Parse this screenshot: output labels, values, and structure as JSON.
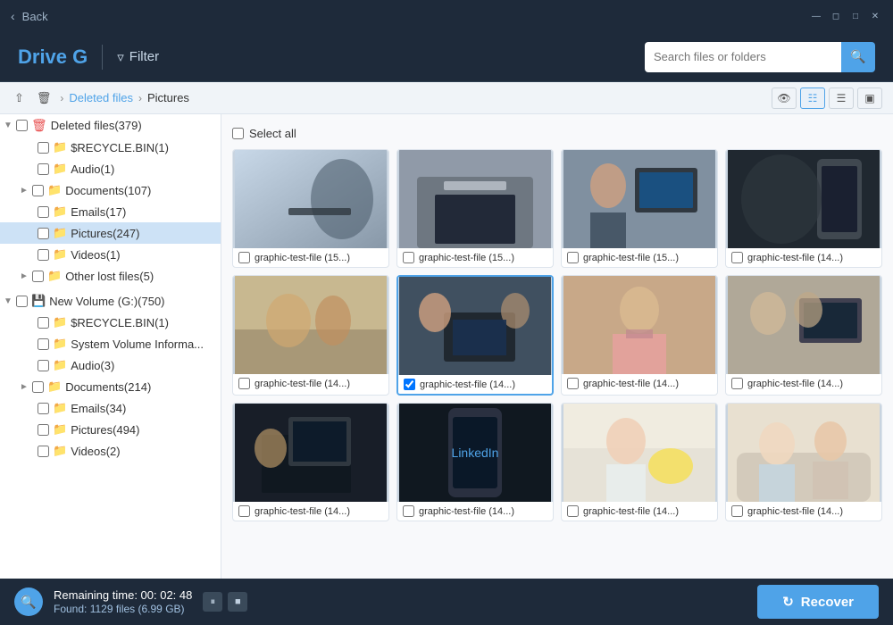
{
  "titleBar": {
    "back_label": "Back",
    "controls": [
      "minimize",
      "maximize",
      "restore",
      "close"
    ]
  },
  "header": {
    "drive_title": "Drive G",
    "filter_label": "Filter",
    "search_placeholder": "Search files or folders"
  },
  "breadcrumb": {
    "up_label": "↑",
    "delete_label": "🗑",
    "items": [
      "Deleted files",
      "Pictures"
    ],
    "view_eye": "👁",
    "view_grid": "⊞",
    "view_list": "≡",
    "view_detail": "⊟"
  },
  "sidebar": {
    "deletedFiles": {
      "label": "Deleted files(379)",
      "children": [
        {
          "label": "$RECYCLE.BIN(1)",
          "indent": 1
        },
        {
          "label": "Audio(1)",
          "indent": 1
        },
        {
          "label": "Documents(107)",
          "indent": 1,
          "hasToggle": true
        },
        {
          "label": "Emails(17)",
          "indent": 1
        },
        {
          "label": "Pictures(247)",
          "indent": 1,
          "selected": true
        },
        {
          "label": "Videos(1)",
          "indent": 1
        },
        {
          "label": "Other lost files(5)",
          "indent": 1,
          "hasToggle": true
        }
      ]
    },
    "newVolume": {
      "label": "New Volume (G:)(750)",
      "children": [
        {
          "label": "$RECYCLE.BIN(1)",
          "indent": 1
        },
        {
          "label": "System Volume Informa...",
          "indent": 1
        },
        {
          "label": "Audio(3)",
          "indent": 1
        },
        {
          "label": "Documents(214)",
          "indent": 1,
          "hasToggle": true
        },
        {
          "label": "Emails(34)",
          "indent": 1
        },
        {
          "label": "Pictures(494)",
          "indent": 1
        },
        {
          "label": "Videos(2)",
          "indent": 1
        }
      ]
    }
  },
  "content": {
    "select_all_label": "Select all",
    "files": [
      {
        "name": "graphic-test-file (15...)",
        "photo_class": "photo-1"
      },
      {
        "name": "graphic-test-file (15...)",
        "photo_class": "photo-2"
      },
      {
        "name": "graphic-test-file (15...)",
        "photo_class": "photo-3"
      },
      {
        "name": "graphic-test-file (14...)",
        "photo_class": "photo-4"
      },
      {
        "name": "graphic-test-file (14...)",
        "photo_class": "photo-5"
      },
      {
        "name": "graphic-test-file (14...)",
        "photo_class": "photo-6",
        "selected": true
      },
      {
        "name": "graphic-test-file (14...)",
        "photo_class": "photo-7"
      },
      {
        "name": "graphic-test-file (14...)",
        "photo_class": "photo-8"
      },
      {
        "name": "graphic-test-file (14...)",
        "photo_class": "photo-9"
      },
      {
        "name": "graphic-test-file (14...)",
        "photo_class": "photo-10"
      },
      {
        "name": "graphic-test-file (14...)",
        "photo_class": "photo-11"
      },
      {
        "name": "graphic-test-file (14...)",
        "photo_class": "photo-12"
      }
    ]
  },
  "bottomBar": {
    "remaining_label": "Remaining time: 00: 02: 48",
    "found_label": "Found: 1129 files (6.99 GB)",
    "pause_label": "⏸",
    "stop_label": "■",
    "recover_label": "Recover"
  }
}
